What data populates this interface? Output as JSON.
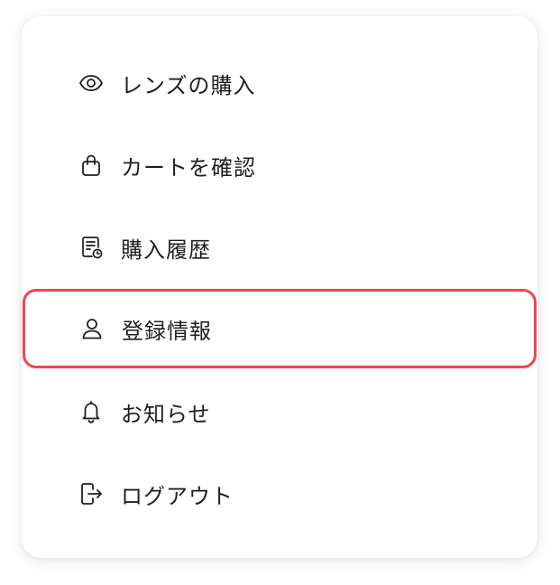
{
  "menu": {
    "items": [
      {
        "label": "レンズの購入",
        "icon": "eye-icon"
      },
      {
        "label": "カートを確認",
        "icon": "shopping-bag-icon"
      },
      {
        "label": "購入履歴",
        "icon": "receipt-clock-icon"
      },
      {
        "label": "登録情報",
        "icon": "user-icon",
        "highlighted": true
      },
      {
        "label": "お知らせ",
        "icon": "bell-icon"
      },
      {
        "label": "ログアウト",
        "icon": "logout-icon"
      }
    ],
    "highlight_color": "#ec4850"
  }
}
